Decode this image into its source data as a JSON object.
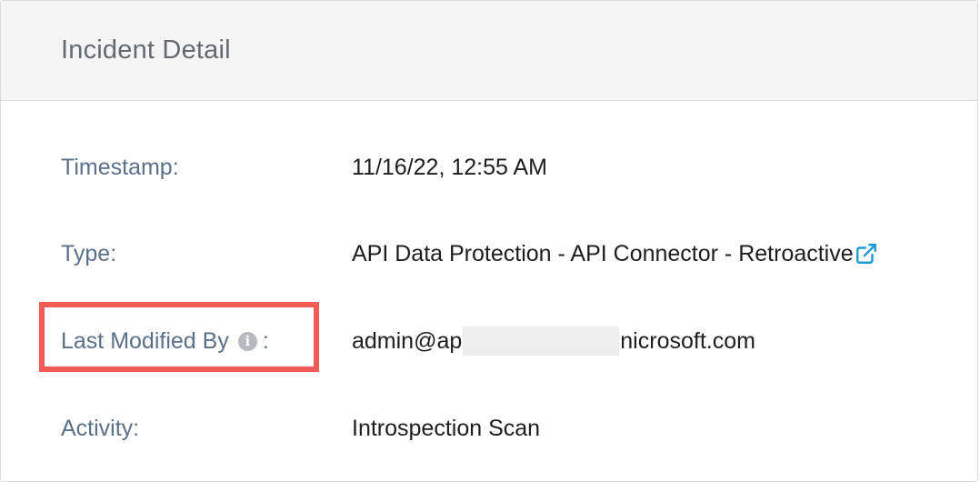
{
  "panel": {
    "title": "Incident Detail"
  },
  "fields": {
    "timestamp": {
      "label": "Timestamp:",
      "value": "11/16/22, 12:55 AM"
    },
    "type": {
      "label": "Type:",
      "value": "API Data Protection - API Connector - Retroactive",
      "link_icon": "external-link-icon"
    },
    "last_modified_by": {
      "label": "Last Modified By",
      "colon": ":",
      "info_icon": "info-icon",
      "value_prefix": "admin@ap",
      "value_suffix": "nicrosoft.com"
    },
    "activity": {
      "label": "Activity:",
      "value": "Introspection Scan"
    }
  },
  "colors": {
    "label": "#5c7089",
    "value": "#1e1e1e",
    "link": "#1b9ad6",
    "highlight": "#f25a55",
    "header_bg": "#f5f5f5"
  }
}
